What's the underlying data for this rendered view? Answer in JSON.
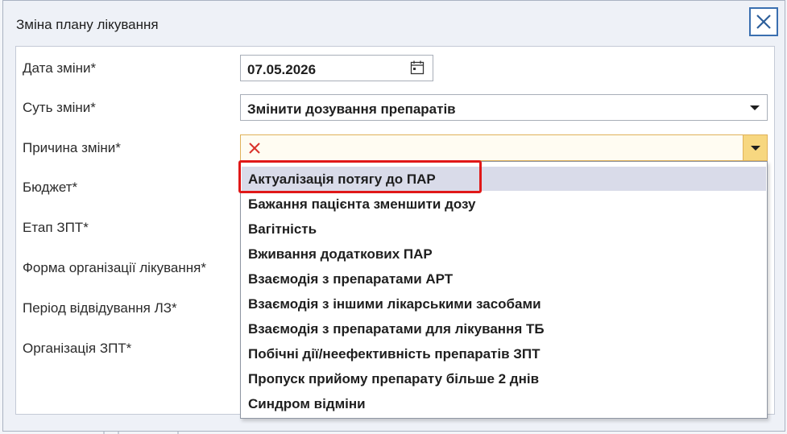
{
  "window": {
    "title": "Зміна плану лікування"
  },
  "form": {
    "date_label": "Дата зміни*",
    "date_value": "07.05.2026",
    "essence_label": "Суть зміни*",
    "essence_value": "Змінити дозування препаратів",
    "reason_label": "Причина зміни*",
    "reason_value": "",
    "budget_label": "Бюджет*",
    "stage_label": "Етап ЗПТ*",
    "form_org_label": "Форма організації лікування*",
    "period_label": "Період відвідування ЛЗ*",
    "organization_label": "Організація ЗПТ*"
  },
  "dropdown": {
    "selected_index": 0,
    "options": [
      "Актуалізація потягу до ПАР",
      "Бажання пацієнта зменшити дозу",
      "Вагітність",
      "Вживання додаткових ПАР",
      "Взаємодія з  препаратами АРТ",
      "Взаємодія з іншими лікарськими засобами",
      "Взаємодія з препаратами для лікування ТБ",
      "Побічні дії/неефективність препаратів ЗПТ",
      "Пропуск прийому препарату більше 2 днів",
      "Синдром відміни"
    ]
  },
  "icons": {
    "close": "close-icon",
    "calendar": "calendar-icon",
    "error": "error-x-icon",
    "dropdown": "chevron-down-icon"
  },
  "colors": {
    "highlight": "#e01818",
    "selected_option": "#d9dbe9",
    "invalid_field": "#fffcf2",
    "invalid_button": "#f7d780",
    "accent": "#3a6fb0"
  }
}
